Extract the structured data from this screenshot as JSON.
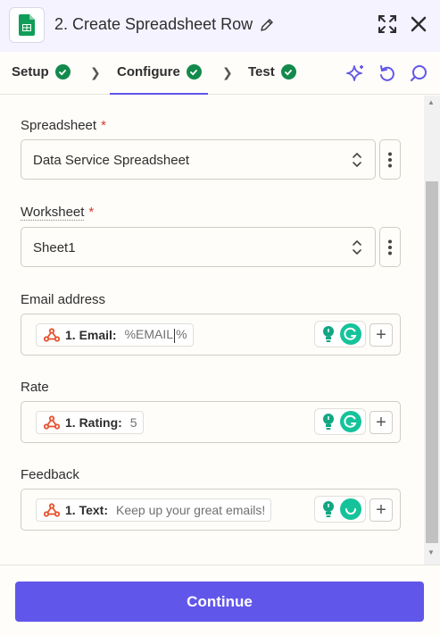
{
  "header": {
    "app_icon": "google-sheets-icon",
    "title": "2. Create Spreadsheet Row",
    "edit_icon": "pencil-icon",
    "expand_icon": "expand-icon",
    "close_icon": "close-icon"
  },
  "tabs": [
    {
      "label": "Setup",
      "status": "complete"
    },
    {
      "label": "Configure",
      "status": "complete",
      "active": true
    },
    {
      "label": "Test",
      "status": "complete"
    }
  ],
  "toolbar_icons": [
    "sparkle-icon",
    "undo-icon",
    "comment-icon"
  ],
  "fields": {
    "spreadsheet": {
      "label": "Spreadsheet",
      "required_mark": "*",
      "value": "Data Service Spreadsheet"
    },
    "worksheet": {
      "label": "Worksheet",
      "required_mark": "*",
      "value": "Sheet1"
    },
    "email": {
      "label": "Email address",
      "pill_key": "1. Email:",
      "pill_value_before": "%EMAIL",
      "pill_value_after": "%"
    },
    "rate": {
      "label": "Rate",
      "pill_key": "1. Rating:",
      "pill_value": "5"
    },
    "feedback": {
      "label": "Feedback",
      "pill_key": "1. Text:",
      "pill_value": "Keep up your great emails!"
    }
  },
  "footer": {
    "continue_label": "Continue"
  },
  "colors": {
    "accent": "#6156ea",
    "success": "#138a4c",
    "required": "#d13a2c",
    "header_bg": "#f4f3ff",
    "grammarly": "#15c39a",
    "webhook": "#e8522e"
  }
}
